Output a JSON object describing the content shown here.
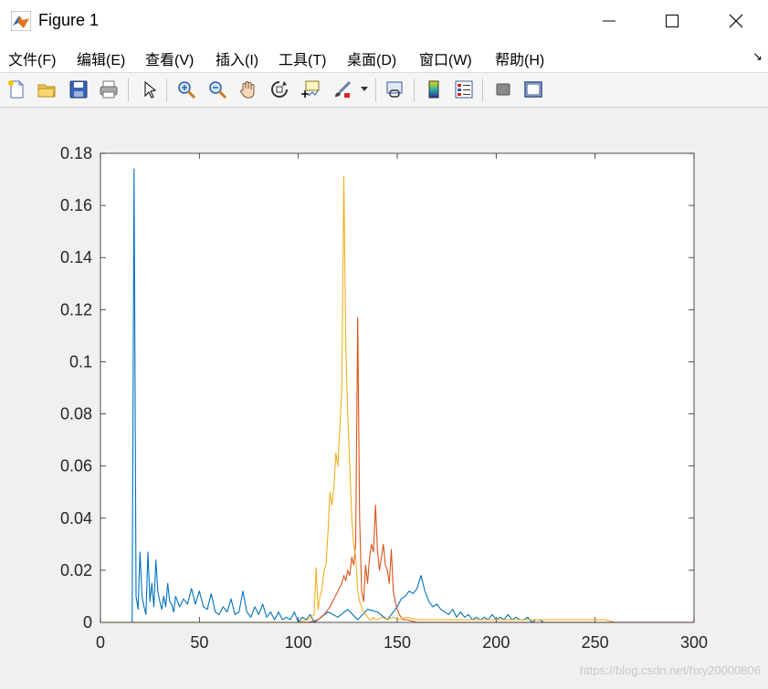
{
  "window": {
    "title": "Figure 1"
  },
  "menu": {
    "items": [
      "文件(F)",
      "编辑(E)",
      "查看(V)",
      "插入(I)",
      "工具(T)",
      "桌面(D)",
      "窗口(W)",
      "帮助(H)"
    ]
  },
  "toolbar": {
    "icons": [
      "new-figure-icon",
      "open-file-icon",
      "save-icon",
      "print-icon",
      "select-pointer-icon",
      "zoom-in-icon",
      "zoom-out-icon",
      "pan-hand-icon",
      "rotate-3d-icon",
      "data-cursor-icon",
      "brush-icon",
      "link-plot-icon",
      "insert-colorbar-icon",
      "insert-legend-icon",
      "hide-plot-tools-icon",
      "show-plot-tools-icon"
    ]
  },
  "watermark": "https://blog.csdn.net/hxy20000806",
  "chart_data": {
    "type": "line",
    "title": "",
    "xlabel": "",
    "ylabel": "",
    "xlim": [
      0,
      300
    ],
    "ylim": [
      0,
      0.18
    ],
    "xticks": [
      0,
      50,
      100,
      150,
      200,
      250,
      300
    ],
    "yticks": [
      0,
      0.02,
      0.04,
      0.06,
      0.08,
      0.1,
      0.12,
      0.14,
      0.16,
      0.18
    ],
    "ytick_labels": [
      "0",
      "0.02",
      "0.04",
      "0.06",
      "0.08",
      "0.1",
      "0.12",
      "0.14",
      "0.16",
      "0.18"
    ],
    "grid": false,
    "legend": "none",
    "colors": [
      "#0072bd",
      "#d95319",
      "#edb120"
    ],
    "series": [
      {
        "x": [
          0,
          16,
          17,
          18,
          19,
          20,
          21,
          22,
          23,
          24,
          25,
          26,
          27,
          28,
          29,
          30,
          31,
          32,
          33,
          34,
          35,
          36,
          37,
          38,
          39,
          40,
          42,
          44,
          46,
          48,
          50,
          52,
          54,
          56,
          58,
          60,
          62,
          64,
          66,
          68,
          70,
          72,
          74,
          76,
          78,
          80,
          82,
          84,
          86,
          88,
          90,
          92,
          94,
          96,
          98,
          100,
          102,
          104,
          106,
          108,
          110,
          115,
          120,
          125,
          130,
          135,
          140,
          145,
          150,
          152,
          154,
          156,
          158,
          160,
          162,
          164,
          166,
          168,
          170,
          172,
          174,
          176,
          178,
          180,
          182,
          184,
          186,
          188,
          190,
          192,
          194,
          196,
          198,
          200,
          202,
          204,
          206,
          208,
          210,
          212,
          214,
          216,
          218,
          220,
          222,
          224,
          226,
          250,
          260
        ],
        "y": [
          0,
          0,
          0.174,
          0.01,
          0.005,
          0.027,
          0.01,
          0.006,
          0.003,
          0.027,
          0.008,
          0.015,
          0.006,
          0.024,
          0.012,
          0.008,
          0.005,
          0.01,
          0.006,
          0.015,
          0.008,
          0.007,
          0.004,
          0.01,
          0.008,
          0.006,
          0.009,
          0.007,
          0.013,
          0.007,
          0.012,
          0.006,
          0.005,
          0.011,
          0.004,
          0.003,
          0.006,
          0.004,
          0.009,
          0.003,
          0.004,
          0.012,
          0.004,
          0.002,
          0.006,
          0.003,
          0.007,
          0.002,
          0.004,
          0.001,
          0.004,
          0.001,
          0.002,
          0.001,
          0.004,
          0,
          0.002,
          0.001,
          0.003,
          0,
          0.001,
          0.004,
          0.002,
          0.005,
          0.001,
          0.005,
          0.004,
          0.001,
          0.006,
          0.009,
          0.01,
          0.012,
          0.011,
          0.013,
          0.018,
          0.012,
          0.008,
          0.006,
          0.007,
          0.005,
          0.004,
          0.003,
          0.005,
          0.002,
          0.004,
          0.002,
          0.003,
          0.001,
          0.002,
          0.001,
          0.002,
          0.001,
          0.003,
          0.001,
          0.002,
          0.001,
          0.003,
          0.001,
          0.002,
          0.001,
          0.001,
          0.002,
          0,
          0.001,
          0.001,
          0,
          0,
          0,
          0
        ]
      },
      {
        "x": [
          0,
          105,
          110,
          113,
          116,
          118,
          120,
          122,
          123,
          124,
          125,
          126,
          127,
          128,
          129,
          130,
          131,
          132,
          133,
          134,
          135,
          136,
          137,
          138,
          139,
          140,
          141,
          142,
          143,
          144,
          145,
          146,
          147,
          148,
          149,
          150,
          151,
          152,
          153,
          155,
          160,
          300
        ],
        "y": [
          0,
          0,
          0.001,
          0.003,
          0.006,
          0.009,
          0.012,
          0.015,
          0.018,
          0.016,
          0.02,
          0.018,
          0.025,
          0.022,
          0.03,
          0.117,
          0.04,
          0.012,
          0.008,
          0.022,
          0.015,
          0.025,
          0.03,
          0.027,
          0.045,
          0.028,
          0.02,
          0.025,
          0.03,
          0.022,
          0.02,
          0.015,
          0.028,
          0.012,
          0.008,
          0.005,
          0.003,
          0.002,
          0.001,
          0.001,
          0,
          0
        ]
      },
      {
        "x": [
          0,
          100,
          105,
          108,
          109,
          110,
          111,
          112,
          113,
          114,
          115,
          116,
          117,
          118,
          119,
          120,
          121,
          122,
          123,
          124,
          125,
          126,
          127,
          128,
          129,
          130,
          131,
          132,
          133,
          134,
          135,
          136,
          137,
          138,
          139,
          140,
          142,
          145,
          148,
          150,
          155,
          160,
          200,
          255,
          260
        ],
        "y": [
          0,
          0,
          0.001,
          0.003,
          0.021,
          0.005,
          0.01,
          0.013,
          0.02,
          0.022,
          0.035,
          0.05,
          0.045,
          0.052,
          0.065,
          0.06,
          0.075,
          0.09,
          0.171,
          0.105,
          0.08,
          0.06,
          0.04,
          0.03,
          0.025,
          0.012,
          0.008,
          0.006,
          0.004,
          0.003,
          0.002,
          0.001,
          0.001,
          0.002,
          0.001,
          0.001,
          0.002,
          0.001,
          0.002,
          0.001,
          0.002,
          0.001,
          0.001,
          0.001,
          0
        ]
      }
    ]
  }
}
